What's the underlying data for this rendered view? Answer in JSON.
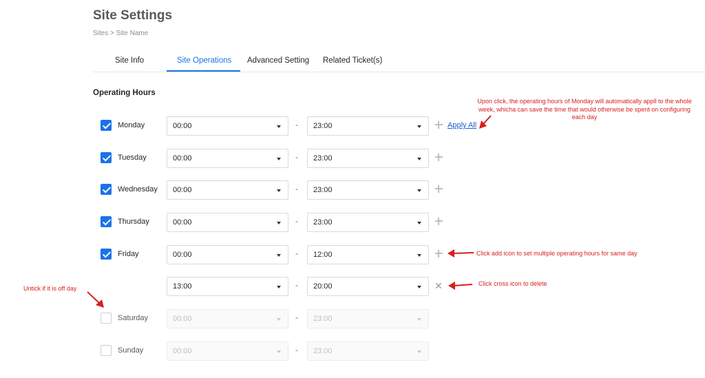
{
  "page": {
    "title": "Site Settings",
    "breadcrumb": "Sites > Site Name"
  },
  "tabs": [
    {
      "label": "Site Info",
      "active": false
    },
    {
      "label": "Site Operations",
      "active": true
    },
    {
      "label": "Advanced Setting",
      "active": false
    },
    {
      "label": "Related Ticket(s)",
      "active": false
    }
  ],
  "section": {
    "title": "Operating Hours"
  },
  "rows": [
    {
      "day": "Monday",
      "checked": true,
      "start": "00:00",
      "end": "23:00"
    },
    {
      "day": "Tuesday",
      "checked": true,
      "start": "00:00",
      "end": "23:00"
    },
    {
      "day": "Wednesday",
      "checked": true,
      "start": "00:00",
      "end": "23:00"
    },
    {
      "day": "Thursday",
      "checked": true,
      "start": "00:00",
      "end": "23:00"
    },
    {
      "day": "Friday",
      "checked": true,
      "start": "00:00",
      "end": "12:00"
    },
    {
      "day": "",
      "checked": true,
      "start": "13:00",
      "end": "20:00"
    },
    {
      "day": "Saturday",
      "checked": false,
      "start": "00:00",
      "end": "23:00"
    },
    {
      "day": "Sunday",
      "checked": false,
      "start": "00:00",
      "end": "23:00"
    }
  ],
  "separator": "-",
  "actions": {
    "apply_all": "Apply All"
  },
  "annotations": {
    "apply_all_note": "Upon click, the operating hours of Monday will automatically appll to the whole week, whicha can save the time that would otherwise be spent on configuring each day",
    "add_note": "Click add icon to set multiple operating hours for same day",
    "delete_note": "Click cross icon to delete",
    "untick_note": "Untick if it is off day"
  },
  "colors": {
    "accent": "#1a73e8",
    "annotation": "#d81e1e"
  },
  "icons": {
    "add": "plus-icon",
    "delete": "cross-icon",
    "dropdown": "caret-down-icon",
    "check": "checkmark-icon"
  }
}
